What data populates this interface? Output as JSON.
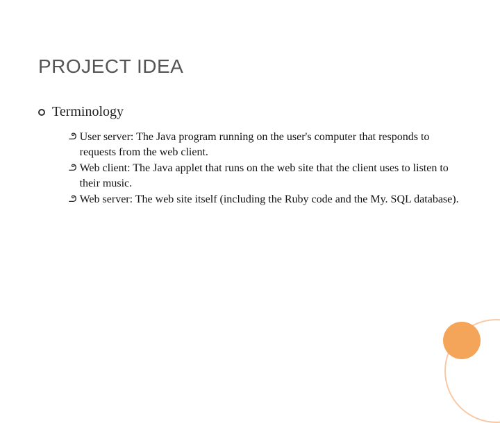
{
  "title": "PROJECT IDEA",
  "section_heading": "Terminology",
  "items": [
    "User server: The Java program running on the user's computer that responds to requests from the web client.",
    "Web client: The Java applet that runs on the web site that the client uses to listen to their music.",
    "Web server: The web site itself (including the Ruby code and the My. SQL database)."
  ]
}
